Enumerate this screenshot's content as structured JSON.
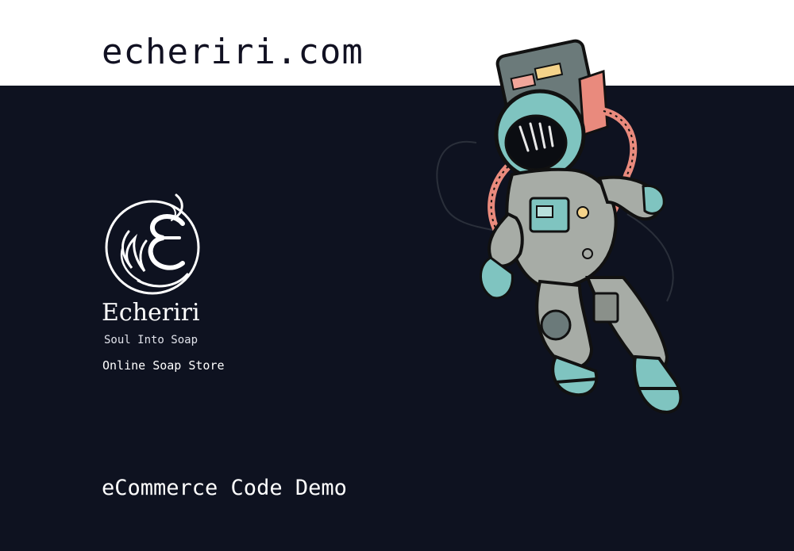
{
  "header": {
    "site_title": "echeriri.com"
  },
  "brand": {
    "logo_icon": "echeriri-logo-icon",
    "name": "Echeriri",
    "tagline": "Soul Into Soap",
    "store_label": "Online Soap Store"
  },
  "hero": {
    "illustration": "astronaut-illustration",
    "demo_label": "eCommerce Code Demo"
  },
  "colors": {
    "background_dark": "#0e1220",
    "background_light": "#ffffff",
    "text_dark": "#111122",
    "text_light": "#ffffff",
    "accent_teal": "#7fc4c0",
    "accent_coral": "#e98a7d",
    "suit_gray": "#a7aca6"
  }
}
